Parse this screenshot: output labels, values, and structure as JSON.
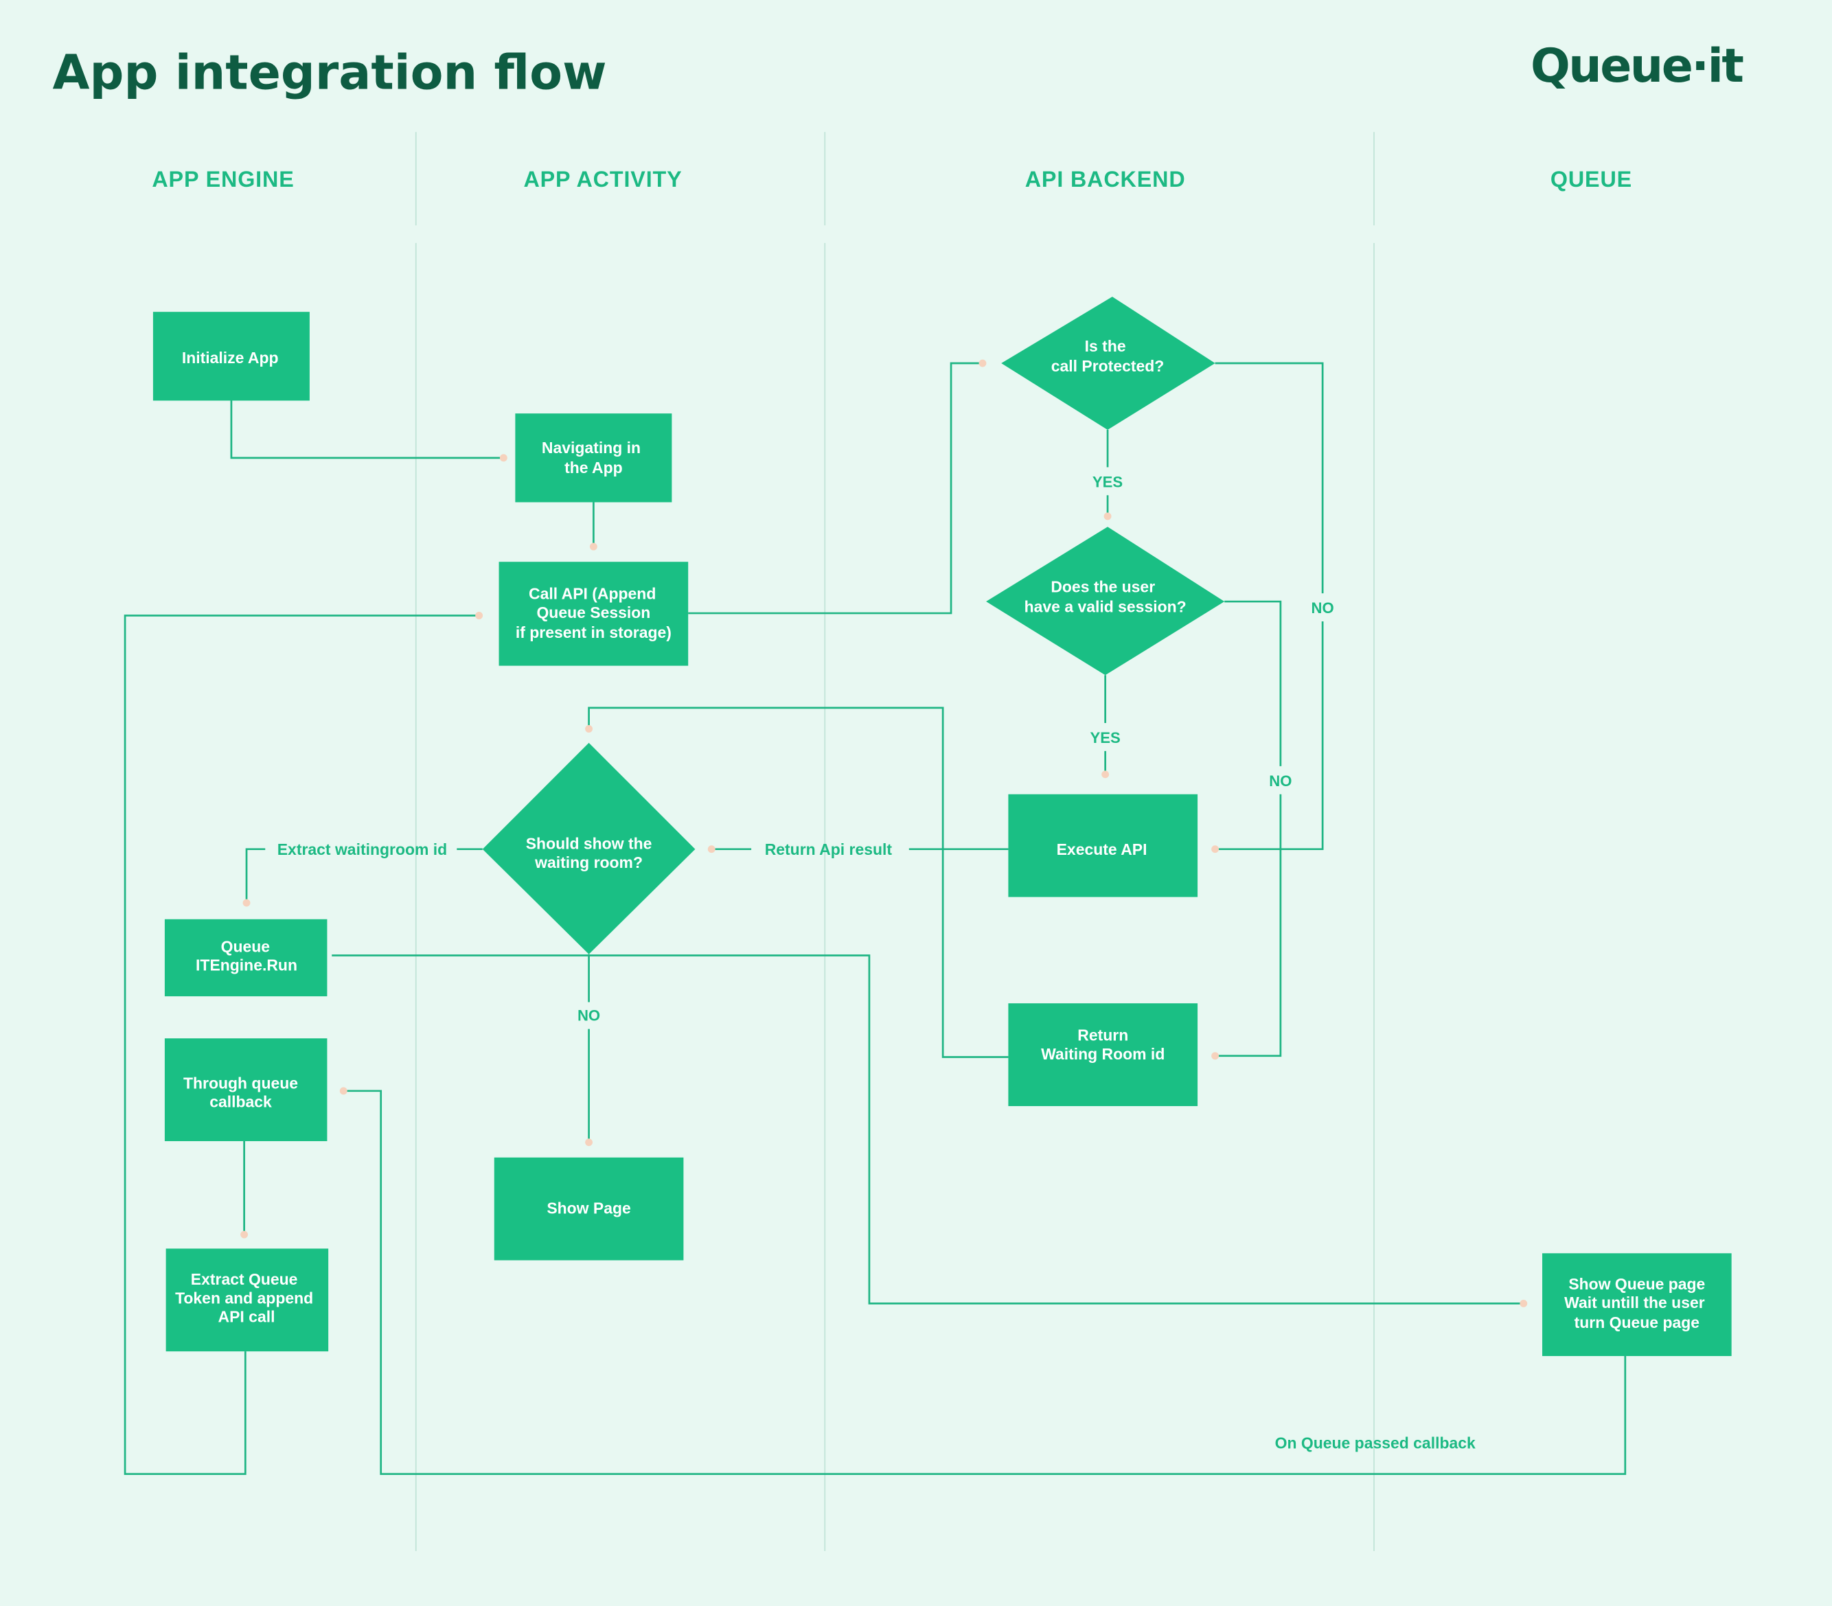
{
  "header": {
    "title": "App integration flow",
    "logo_text": "Queue·it"
  },
  "colors": {
    "background": "#e8f8f2",
    "node_fill": "#1abf84",
    "title": "#0e5c42",
    "lane_title": "#1cb983",
    "connector": "#1fb584",
    "connector_dot": "#f6d2bd",
    "node_text": "#ffffff"
  },
  "lanes": [
    {
      "id": "app-engine",
      "label": "APP ENGINE"
    },
    {
      "id": "app-activity",
      "label": "APP ACTIVITY"
    },
    {
      "id": "api-backend",
      "label": "API BACKEND"
    },
    {
      "id": "queue",
      "label": "QUEUE"
    }
  ],
  "nodes": {
    "initialize_app": {
      "shape": "rect",
      "lane": "app-engine",
      "lines": [
        "Initialize App"
      ]
    },
    "navigating": {
      "shape": "rect",
      "lane": "app-activity",
      "lines": [
        "Navigating in",
        "the App"
      ]
    },
    "call_api": {
      "shape": "rect",
      "lane": "app-activity",
      "lines": [
        "Call API (Append",
        "Queue Session",
        "if present in storage)"
      ]
    },
    "is_protected": {
      "shape": "diamond",
      "lane": "api-backend",
      "lines": [
        "Is the",
        "call Protected?"
      ]
    },
    "valid_session": {
      "shape": "diamond",
      "lane": "api-backend",
      "lines": [
        "Does the user",
        "have a valid session?"
      ]
    },
    "execute_api": {
      "shape": "rect",
      "lane": "api-backend",
      "lines": [
        "Execute API"
      ]
    },
    "return_wr_id": {
      "shape": "rect",
      "lane": "api-backend",
      "lines": [
        "Return",
        "Waiting Room id"
      ]
    },
    "should_show_wr": {
      "shape": "diamond",
      "lane": "app-activity",
      "lines": [
        "Should show the",
        "waiting room?"
      ]
    },
    "queue_run": {
      "shape": "rect",
      "lane": "app-engine",
      "lines": [
        "Queue",
        "ITEngine.Run"
      ]
    },
    "through_callback": {
      "shape": "rect",
      "lane": "app-engine",
      "lines": [
        "Through queue",
        "callback"
      ]
    },
    "extract_token": {
      "shape": "rect",
      "lane": "app-engine",
      "lines": [
        "Extract Queue",
        "Token and append",
        "API call"
      ]
    },
    "show_page": {
      "shape": "rect",
      "lane": "app-activity",
      "lines": [
        "Show Page"
      ]
    },
    "show_queue_page": {
      "shape": "rect",
      "lane": "queue",
      "lines": [
        "Show Queue page",
        "Wait untill the user",
        "turn Queue page"
      ]
    }
  },
  "edges": [
    {
      "from": "initialize_app",
      "to": "navigating",
      "label": ""
    },
    {
      "from": "navigating",
      "to": "call_api",
      "label": ""
    },
    {
      "from": "call_api",
      "to": "is_protected",
      "label": ""
    },
    {
      "from": "is_protected",
      "to": "valid_session",
      "label": "YES"
    },
    {
      "from": "is_protected",
      "to": "execute_api",
      "label": "NO"
    },
    {
      "from": "valid_session",
      "to": "execute_api",
      "label": "YES"
    },
    {
      "from": "valid_session",
      "to": "return_wr_id",
      "label": "NO"
    },
    {
      "from": "execute_api",
      "to": "should_show_wr",
      "label": "Return Api result"
    },
    {
      "from": "return_wr_id",
      "to": "should_show_wr",
      "label": ""
    },
    {
      "from": "should_show_wr",
      "to": "queue_run",
      "label": "Extract waitingroom id"
    },
    {
      "from": "should_show_wr",
      "to": "show_page",
      "label": "NO"
    },
    {
      "from": "queue_run",
      "to": "show_queue_page",
      "label": ""
    },
    {
      "from": "show_queue_page",
      "to": "through_callback",
      "label": "On Queue passed callback"
    },
    {
      "from": "through_callback",
      "to": "extract_token",
      "label": ""
    },
    {
      "from": "extract_token",
      "to": "call_api",
      "label": ""
    }
  ],
  "edge_labels": {
    "yes_protected": "YES",
    "no_protected": "NO",
    "yes_session": "YES",
    "no_session": "NO",
    "return_api_result": "Return Api result",
    "extract_waitingroom_id": "Extract waitingroom id",
    "no_show_wr": "NO",
    "on_queue_passed": "On Queue passed callback"
  }
}
